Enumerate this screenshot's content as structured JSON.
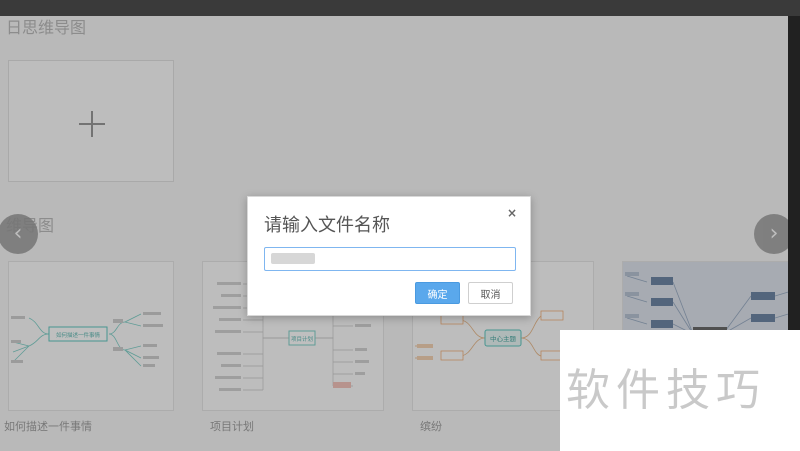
{
  "sections": {
    "my_maps": "日思维导图",
    "templates": "维导图"
  },
  "templates": [
    {
      "label": "如何描述一件事情",
      "center": "如何描述一件事情"
    },
    {
      "label": "项目计划",
      "center": "项目计划"
    },
    {
      "label": "缤纷",
      "center": "中心主题"
    },
    {
      "label": "",
      "center": ""
    }
  ],
  "dialog": {
    "title": "请输入文件名称",
    "close_symbol": "×",
    "ok_label": "确定",
    "cancel_label": "取消"
  },
  "carousel": {
    "prev_symbol": "‹",
    "next_symbol": "›"
  },
  "watermark": "软件技巧",
  "colors": {
    "accent": "#5aa8ec",
    "teal": "#5fc7c0",
    "orange": "#f2a86b",
    "slate": "#6f87a6"
  }
}
